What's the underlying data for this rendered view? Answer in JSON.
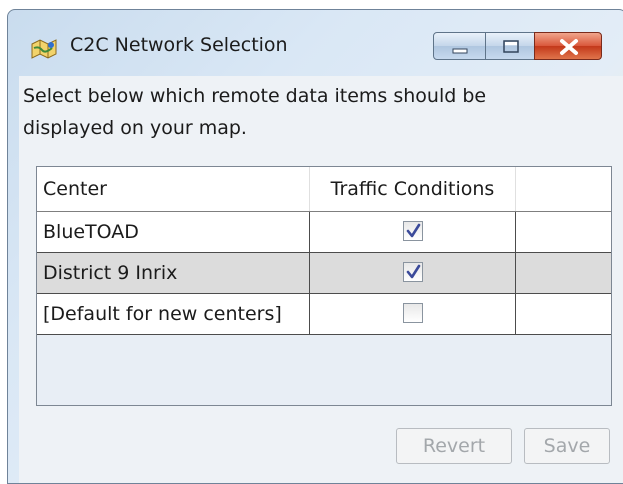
{
  "window": {
    "title": "C2C Network Selection",
    "minimize_icon": "minimize-icon",
    "maximize_icon": "maximize-icon",
    "close_icon": "close-icon"
  },
  "instruction": "Select below which remote data items should be displayed on your map.",
  "grid": {
    "columns": [
      "Center",
      "Traffic Conditions",
      ""
    ],
    "rows": [
      {
        "center": "BlueTOAD",
        "traffic_conditions": true
      },
      {
        "center": "District 9 Inrix",
        "traffic_conditions": true
      },
      {
        "center": "[Default for new centers]",
        "traffic_conditions": false
      }
    ]
  },
  "buttons": {
    "revert": "Revert",
    "save": "Save"
  },
  "colors": {
    "check": "#3b4a9a",
    "close_button": "#c3381a"
  }
}
